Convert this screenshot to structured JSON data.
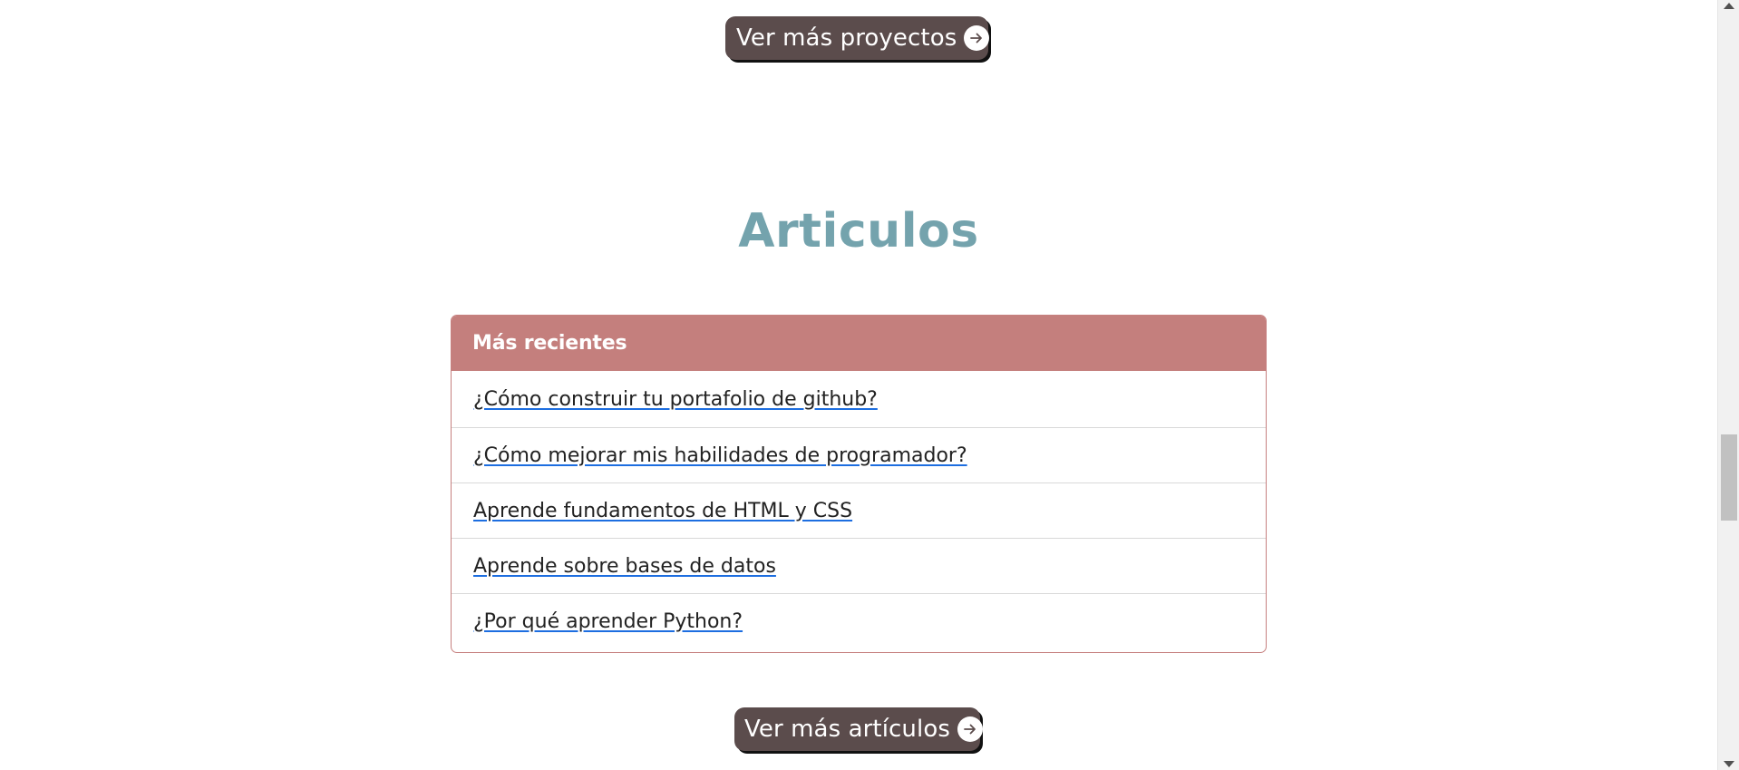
{
  "projects_button": {
    "label": "Ver más proyectos",
    "icon": "arrow-right-circle-icon"
  },
  "articles_section": {
    "title": "Articulos",
    "title_color": "#74a3ad",
    "card": {
      "header": "Más recientes",
      "header_color": "#c47f7d",
      "items": [
        {
          "label": "¿Cómo construir tu portafolio de github?"
        },
        {
          "label": "¿Cómo mejorar mis habilidades de programador?"
        },
        {
          "label": "Aprende fundamentos de HTML y CSS"
        },
        {
          "label": "Aprende sobre bases de datos"
        },
        {
          "label": "¿Por qué aprender Python?"
        }
      ]
    }
  },
  "articles_button": {
    "label": "Ver más artículos",
    "icon": "arrow-right-circle-icon"
  },
  "colors": {
    "button_background": "#5b4c4c",
    "link_underline": "#1d6ee0"
  },
  "scrollbar": {
    "scroll_position": 0.6
  }
}
